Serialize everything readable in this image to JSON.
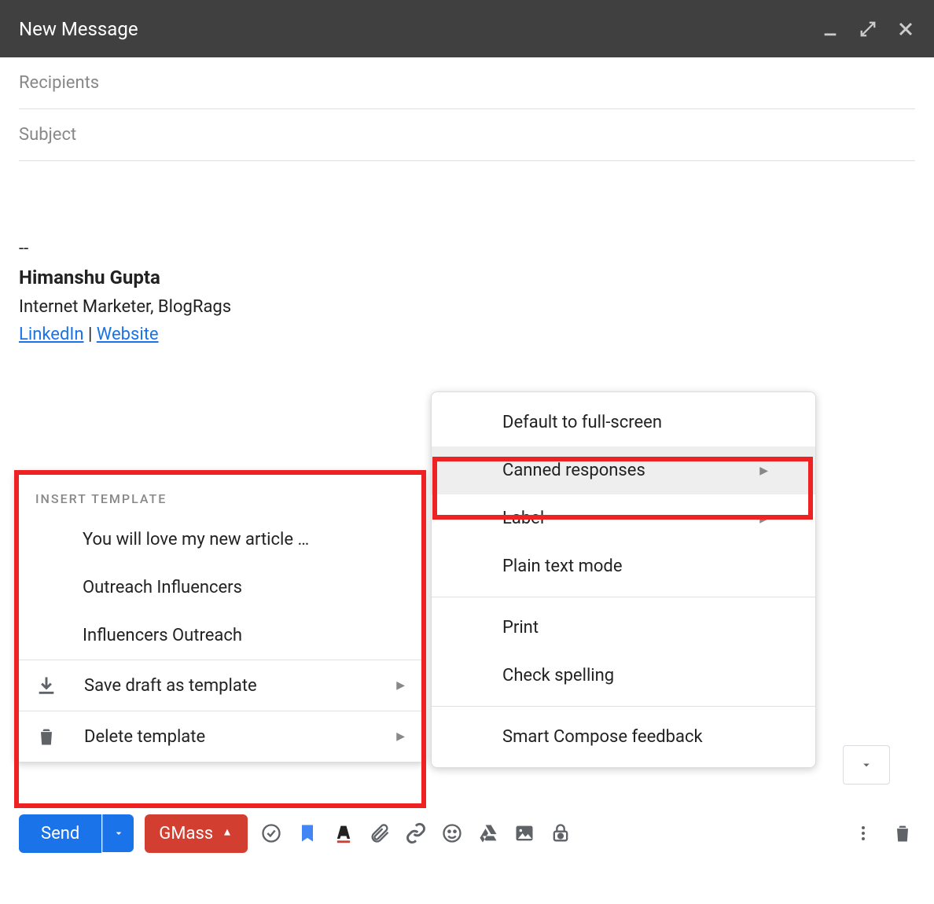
{
  "titlebar": {
    "title": "New Message"
  },
  "fields": {
    "recipients_label": "Recipients",
    "subject_label": "Subject"
  },
  "signature": {
    "sep": "--",
    "name": "Himanshu Gupta",
    "role": "Internet Marketer, BlogRags",
    "link1": "LinkedIn",
    "pipe": " | ",
    "link2": "Website"
  },
  "toolbar": {
    "send": "Send",
    "gmass": "GMass"
  },
  "menu": {
    "items": [
      "Default to full-screen",
      "Canned responses",
      "Label",
      "Plain text mode",
      "Print",
      "Check spelling",
      "Smart Compose feedback"
    ]
  },
  "submenu": {
    "header": "INSERT TEMPLATE",
    "templates": [
      "You will love my new article …",
      "Outreach Influencers",
      "Influencers Outreach"
    ],
    "save": "Save draft as template",
    "delete": "Delete template"
  }
}
